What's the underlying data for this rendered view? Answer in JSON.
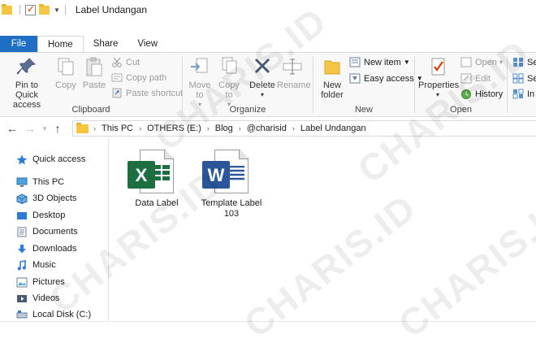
{
  "window": {
    "title": "Label Undangan"
  },
  "tabs": [
    {
      "label": "File"
    },
    {
      "label": "Home"
    },
    {
      "label": "Share"
    },
    {
      "label": "View"
    }
  ],
  "ribbon": {
    "clipboard": {
      "group_label": "Clipboard",
      "pin": "Pin to Quick access",
      "copy": "Copy",
      "paste": "Paste",
      "cut": "Cut",
      "copy_path": "Copy path",
      "paste_shortcut": "Paste shortcut"
    },
    "organize": {
      "group_label": "Organize",
      "move_to": "Move to",
      "copy_to": "Copy to",
      "delete": "Delete",
      "rename": "Rename"
    },
    "new": {
      "group_label": "New",
      "new_folder": "New folder",
      "new_item": "New item",
      "easy_access": "Easy access"
    },
    "open": {
      "group_label": "Open",
      "properties": "Properties",
      "open": "Open",
      "edit": "Edit",
      "history": "History"
    },
    "select": {
      "item1": "Se",
      "item2": "Se",
      "item3": "In"
    }
  },
  "address": {
    "crumbs": [
      "This PC",
      "OTHERS (E:)",
      "Blog",
      "@charisid",
      "Label Undangan"
    ]
  },
  "nav": {
    "items": [
      {
        "label": "Quick access"
      },
      {
        "label": "This PC"
      },
      {
        "label": "3D Objects"
      },
      {
        "label": "Desktop"
      },
      {
        "label": "Documents"
      },
      {
        "label": "Downloads"
      },
      {
        "label": "Music"
      },
      {
        "label": "Pictures"
      },
      {
        "label": "Videos"
      },
      {
        "label": "Local Disk (C:)"
      }
    ]
  },
  "files": [
    {
      "name": "Data Label",
      "type_letter": "X"
    },
    {
      "name_line1": "Template Label",
      "name_line2": "103",
      "type_letter": "W"
    }
  ],
  "watermark": "CHARIS.ID",
  "colors": {
    "file_tab": "#1e6fc3",
    "excel": "#1d6f42",
    "word": "#2b579a",
    "folder": "#f5c544"
  }
}
